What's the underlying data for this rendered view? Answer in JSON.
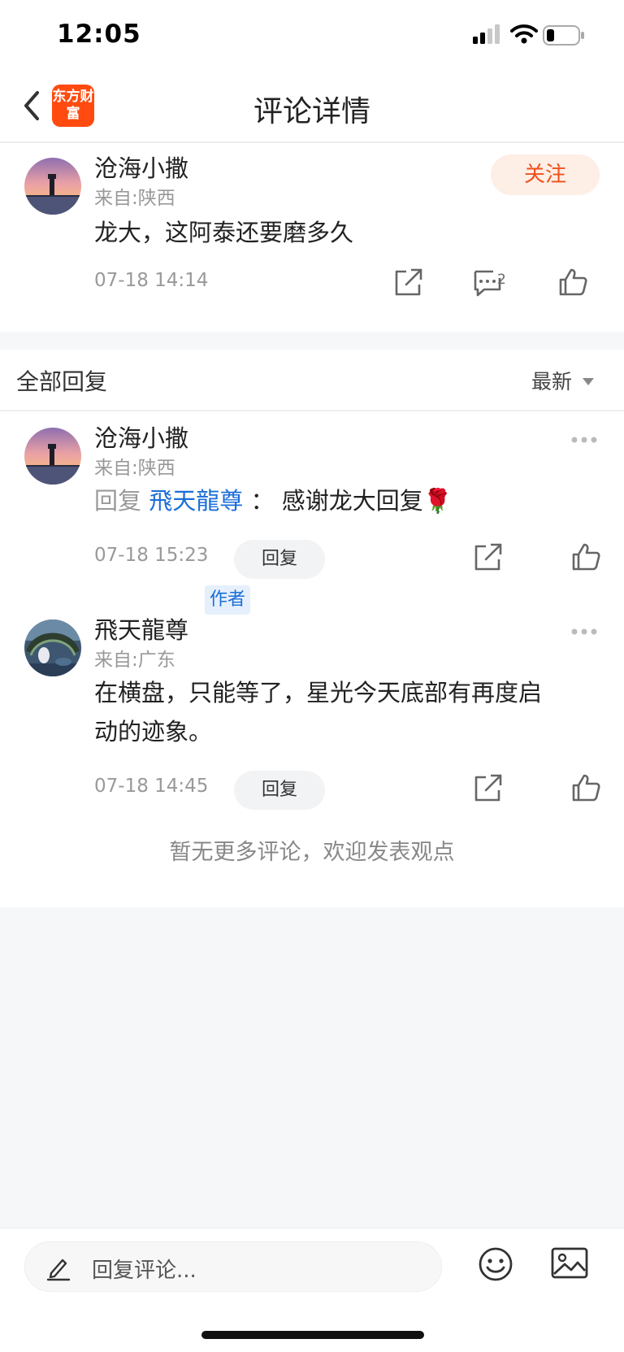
{
  "status_bar": {
    "time": "12:05"
  },
  "nav": {
    "title": "评论详情",
    "app_logo_text": "东方财富"
  },
  "main_comment": {
    "user_name": "沧海小撒",
    "location": "来自:陕西",
    "text": "龙大，这阿泰还要磨多久",
    "timestamp": "07-18 14:14",
    "follow_label": "关注",
    "reply_count": "2"
  },
  "replies": {
    "header_title": "全部回复",
    "sort_label": "最新",
    "items": [
      {
        "user_name": "沧海小撒",
        "location": "来自:陕西",
        "reply_prefix": "回复",
        "mention": "飛天龍尊",
        "separator": "：",
        "text": "感谢龙大回复🌹",
        "timestamp": "07-18 15:23",
        "reply_button": "回复"
      },
      {
        "user_name": "飛天龍尊",
        "badge": "作者",
        "location": "来自:广东",
        "text_line1": "在横盘，只能等了，星光今天底部有再度启",
        "text_line2": "动的迹象。",
        "timestamp": "07-18 14:45",
        "reply_button": "回复"
      }
    ],
    "no_more_text": "暂无更多评论，欢迎发表观点"
  },
  "bottom_bar": {
    "input_placeholder": "回复评论..."
  },
  "icons": {
    "back": "chevron-left-icon",
    "share": "share-icon",
    "comment": "comment-icon",
    "like": "thumbs-up-icon",
    "more": "more-icon",
    "pencil": "pencil-icon",
    "emoji": "emoji-icon",
    "image": "image-icon"
  },
  "colors": {
    "brand": "#ff4b0f",
    "follow_text": "#f0501b",
    "follow_bg": "#fdeee6",
    "mention": "#1a6ed8",
    "muted": "#999999"
  }
}
